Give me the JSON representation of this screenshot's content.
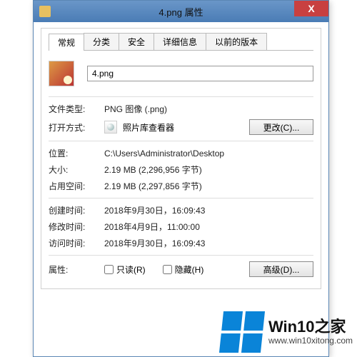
{
  "titlebar": {
    "title": "4.png 属性",
    "close_glyph": "X"
  },
  "tabs": {
    "general": "常规",
    "categories": "分类",
    "security": "安全",
    "details": "详细信息",
    "previous": "以前的版本"
  },
  "file": {
    "name": "4.png"
  },
  "labels": {
    "file_type": "文件类型:",
    "open_with": "打开方式:",
    "location": "位置:",
    "size": "大小:",
    "size_on_disk": "占用空间:",
    "created": "创建时间:",
    "modified": "修改时间:",
    "accessed": "访问时间:",
    "attributes": "属性:"
  },
  "values": {
    "file_type": "PNG 图像 (.png)",
    "open_with_app": "照片库查看器",
    "location": "C:\\Users\\Administrator\\Desktop",
    "size": "2.19 MB (2,296,956 字节)",
    "size_on_disk": "2.19 MB (2,297,856 字节)",
    "created": "2018年9月30日，16:09:43",
    "modified": "2018年4月9日，11:00:00",
    "accessed": "2018年9月30日，16:09:43"
  },
  "buttons": {
    "change": "更改(C)...",
    "advanced": "高级(D)..."
  },
  "attributes": {
    "readonly_label": "只读(R)",
    "hidden_label": "隐藏(H)",
    "readonly_checked": false,
    "hidden_checked": false
  },
  "watermark": {
    "title": "Win10之家",
    "url": "www.win10xitong.com"
  }
}
